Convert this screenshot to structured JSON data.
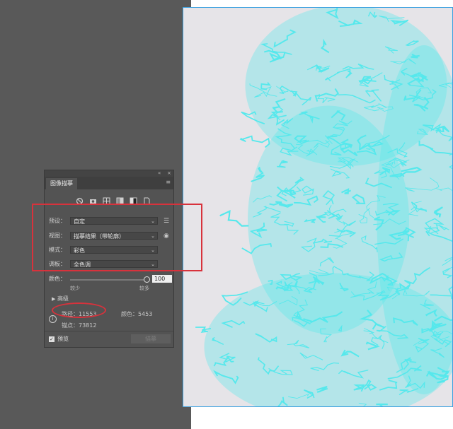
{
  "panel": {
    "title": "图像描摹",
    "icons": [
      "auto-color-icon",
      "camera-icon",
      "grid-icon",
      "grayscale-icon",
      "black-white-icon",
      "outline-icon"
    ],
    "rows": [
      {
        "label": "预设：",
        "value": "自定"
      },
      {
        "label": "视图：",
        "value": "描摹结果（带轮廓）"
      },
      {
        "label": "模式：",
        "value": "彩色"
      },
      {
        "label": "调板：",
        "value": "全色调"
      }
    ],
    "color_label": "颜色：",
    "color_value": "100",
    "min_label": "较少",
    "max_label": "较多",
    "advanced_label": "高级",
    "paths_label": "路径：",
    "paths_value": "11553",
    "colors_label": "颜色：",
    "colors_value": "5453",
    "anchors_label": "锚点：",
    "anchors_value": "73812",
    "preview_label": "预览",
    "trace_button": "描摹",
    "slider_level": 1.0
  },
  "colors": {
    "accent_red": "#d8323c",
    "trace_cyan": "#56e8ec",
    "artboard_border": "#3aa0e0"
  }
}
